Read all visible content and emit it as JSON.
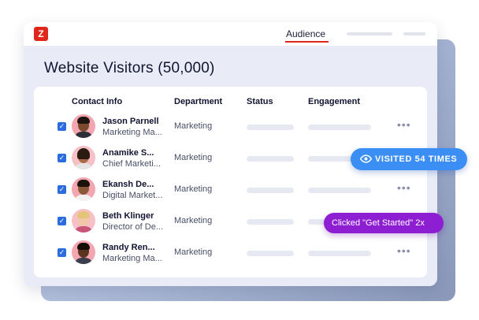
{
  "app": {
    "logo_letter": "Z",
    "tab_label": "Audience",
    "brand_color": "#e1261c"
  },
  "page_title": "Website Visitors (50,000)",
  "table": {
    "columns": [
      "Contact Info",
      "Department",
      "Status",
      "Engagement"
    ],
    "rows": [
      {
        "name": "Jason Parnell",
        "title": "Marketing Ma...",
        "department": "Marketing",
        "checked": true
      },
      {
        "name": "Anamike S...",
        "title": "Chief Marketi...",
        "department": "Marketing",
        "checked": true
      },
      {
        "name": "Ekansh De...",
        "title": "Digital Market...",
        "department": "Marketing",
        "checked": true
      },
      {
        "name": "Beth Klinger",
        "title": "Director of De...",
        "department": "Marketing",
        "checked": true
      },
      {
        "name": "Randy Ren...",
        "title": "Marketing Ma...",
        "department": "Marketing",
        "checked": true
      }
    ],
    "more_icon": "•••"
  },
  "badges": {
    "visited": {
      "icon": "eye-icon",
      "text": "VISITED 54 TIMES",
      "color": "#3b8ef4"
    },
    "clicked": {
      "text": "Clicked \"Get Started\" 2x",
      "color": "#8e1ed1"
    }
  }
}
